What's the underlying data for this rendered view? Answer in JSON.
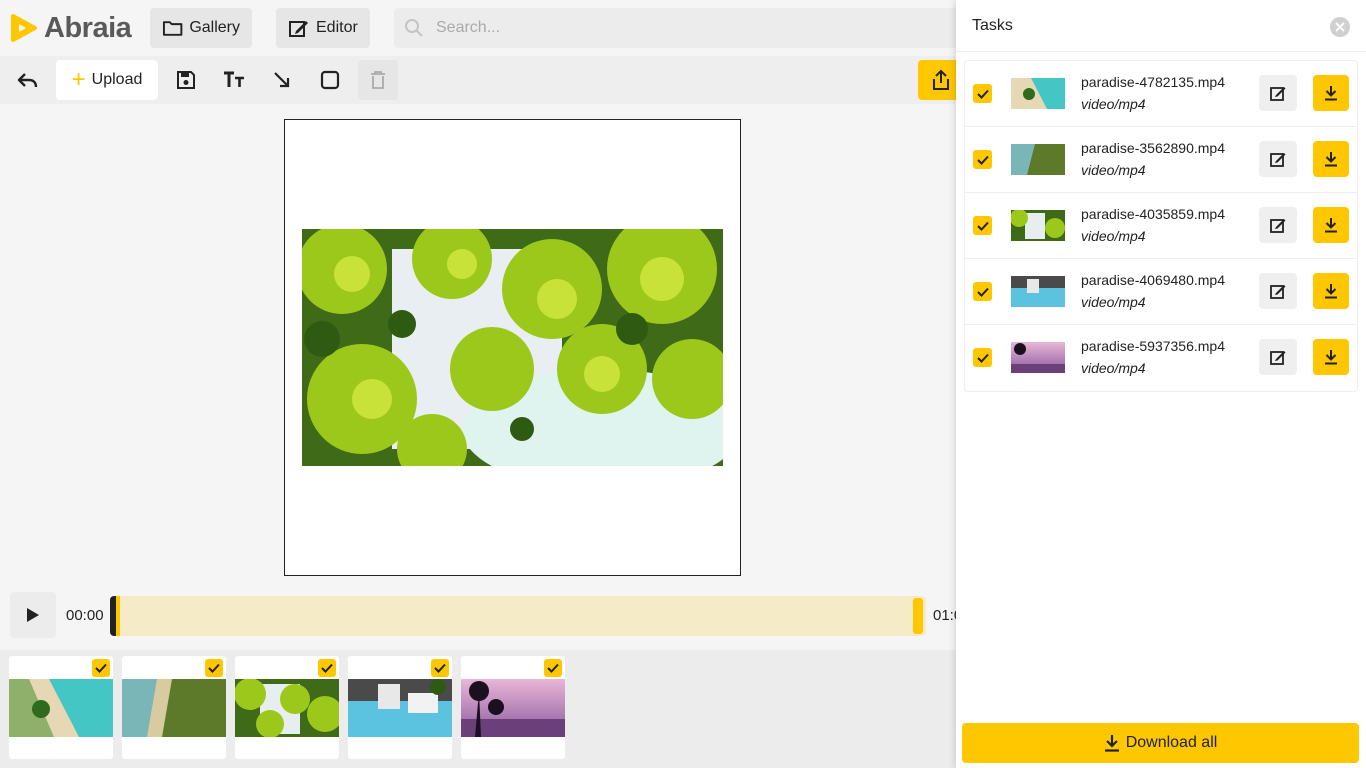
{
  "app": {
    "brand": "Abraia",
    "brand_color": "#ffc700"
  },
  "nav": {
    "gallery_label": "Gallery",
    "editor_label": "Editor"
  },
  "search": {
    "placeholder": "Search..."
  },
  "toolbar": {
    "upload_label": "Upload",
    "icons": [
      "undo-icon",
      "save-icon",
      "text-icon",
      "arrow-icon",
      "rectangle-icon",
      "trash-icon",
      "share-icon"
    ]
  },
  "timeline": {
    "start_time": "00:00",
    "end_time": "01:0",
    "trim_start_fraction": 0.0,
    "trim_end_fraction": 1.0
  },
  "strip": {
    "thumbs": [
      {
        "checked": true,
        "scene": "beach"
      },
      {
        "checked": true,
        "scene": "coast"
      },
      {
        "checked": true,
        "scene": "palms"
      },
      {
        "checked": true,
        "scene": "resort"
      },
      {
        "checked": true,
        "scene": "sunset"
      }
    ]
  },
  "panel": {
    "title": "Tasks",
    "download_all_label": "Download all",
    "tasks": [
      {
        "name": "paradise-4782135.mp4",
        "type": "video/mp4",
        "checked": true,
        "scene": "beach"
      },
      {
        "name": "paradise-3562890.mp4",
        "type": "video/mp4",
        "checked": true,
        "scene": "coast"
      },
      {
        "name": "paradise-4035859.mp4",
        "type": "video/mp4",
        "checked": true,
        "scene": "palms"
      },
      {
        "name": "paradise-4069480.mp4",
        "type": "video/mp4",
        "checked": true,
        "scene": "resort"
      },
      {
        "name": "paradise-5937356.mp4",
        "type": "video/mp4",
        "checked": true,
        "scene": "sunset"
      }
    ]
  }
}
